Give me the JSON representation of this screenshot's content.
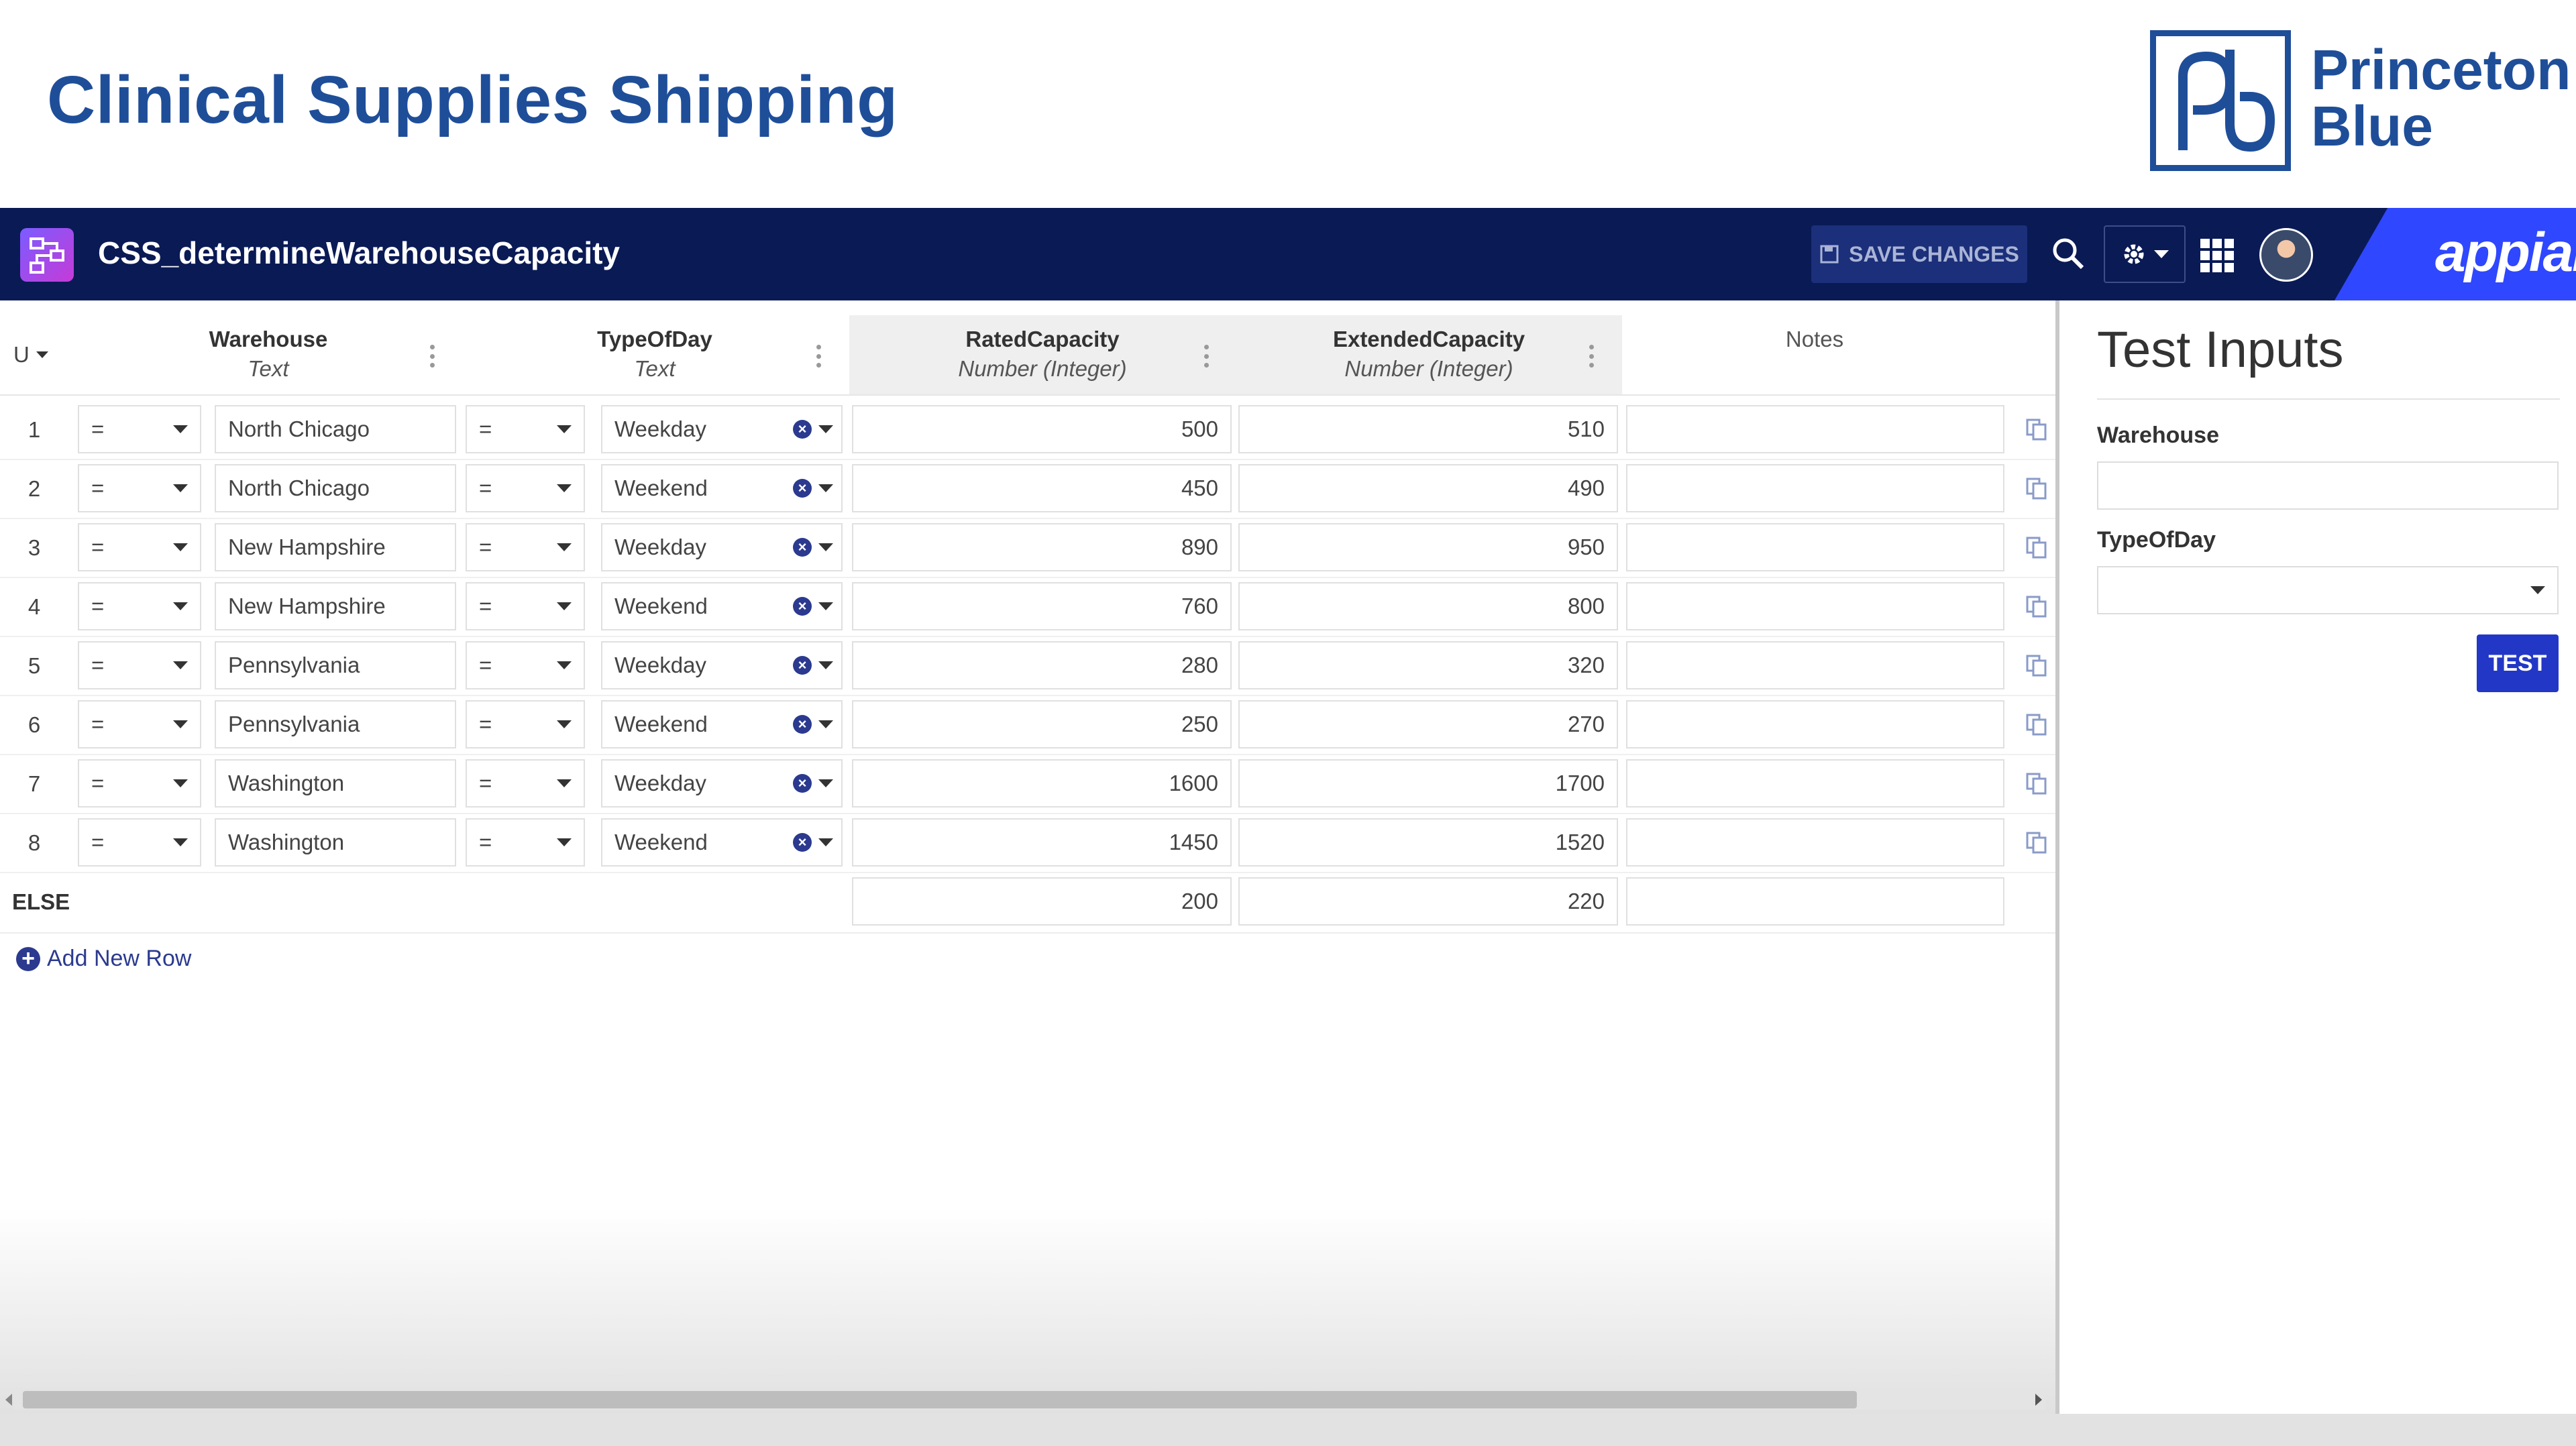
{
  "slide": {
    "title": "Clinical Supplies Shipping",
    "logo_line1": "Princeton",
    "logo_line2": "Blue"
  },
  "appbar": {
    "title": "CSS_determineWarehouseCapacity",
    "save_label": "SAVE CHANGES",
    "brand": "appian"
  },
  "table": {
    "hit_policy": "U",
    "columns": [
      {
        "name": "Warehouse",
        "type": "Text"
      },
      {
        "name": "TypeOfDay",
        "type": "Text"
      },
      {
        "name": "RatedCapacity",
        "type": "Number (Integer)"
      },
      {
        "name": "ExtendedCapacity",
        "type": "Number (Integer)"
      },
      {
        "name": "Notes",
        "type": ""
      }
    ],
    "rows": [
      {
        "num": "1",
        "op1": "=",
        "warehouse": "North Chicago",
        "op2": "=",
        "day": "Weekday",
        "rated": "500",
        "extended": "510",
        "notes": ""
      },
      {
        "num": "2",
        "op1": "=",
        "warehouse": "North Chicago",
        "op2": "=",
        "day": "Weekend",
        "rated": "450",
        "extended": "490",
        "notes": ""
      },
      {
        "num": "3",
        "op1": "=",
        "warehouse": "New Hampshire",
        "op2": "=",
        "day": "Weekday",
        "rated": "890",
        "extended": "950",
        "notes": ""
      },
      {
        "num": "4",
        "op1": "=",
        "warehouse": "New Hampshire",
        "op2": "=",
        "day": "Weekend",
        "rated": "760",
        "extended": "800",
        "notes": ""
      },
      {
        "num": "5",
        "op1": "=",
        "warehouse": "Pennsylvania",
        "op2": "=",
        "day": "Weekday",
        "rated": "280",
        "extended": "320",
        "notes": ""
      },
      {
        "num": "6",
        "op1": "=",
        "warehouse": "Pennsylvania",
        "op2": "=",
        "day": "Weekend",
        "rated": "250",
        "extended": "270",
        "notes": ""
      },
      {
        "num": "7",
        "op1": "=",
        "warehouse": "Washington",
        "op2": "=",
        "day": "Weekday",
        "rated": "1600",
        "extended": "1700",
        "notes": ""
      },
      {
        "num": "8",
        "op1": "=",
        "warehouse": "Washington",
        "op2": "=",
        "day": "Weekend",
        "rated": "1450",
        "extended": "1520",
        "notes": ""
      }
    ],
    "else": {
      "label": "ELSE",
      "rated": "200",
      "extended": "220",
      "notes": ""
    },
    "add_row_label": "Add New Row"
  },
  "test_panel": {
    "title": "Test Inputs",
    "warehouse_label": "Warehouse",
    "warehouse_value": "",
    "typeofday_label": "TypeOfDay",
    "typeofday_value": "",
    "test_button": "TEST"
  },
  "colors": {
    "title_blue": "#1f4e99",
    "appbar_navy": "#0a1a55",
    "appian_blue": "#2f47ff",
    "action_blue": "#2337c6"
  },
  "icons": [
    "app-designer-icon",
    "save-icon",
    "search-icon",
    "gear-icon",
    "grid-menu-icon",
    "avatar",
    "kebab-icon",
    "clear-icon",
    "copy-row-icon",
    "add-icon"
  ]
}
